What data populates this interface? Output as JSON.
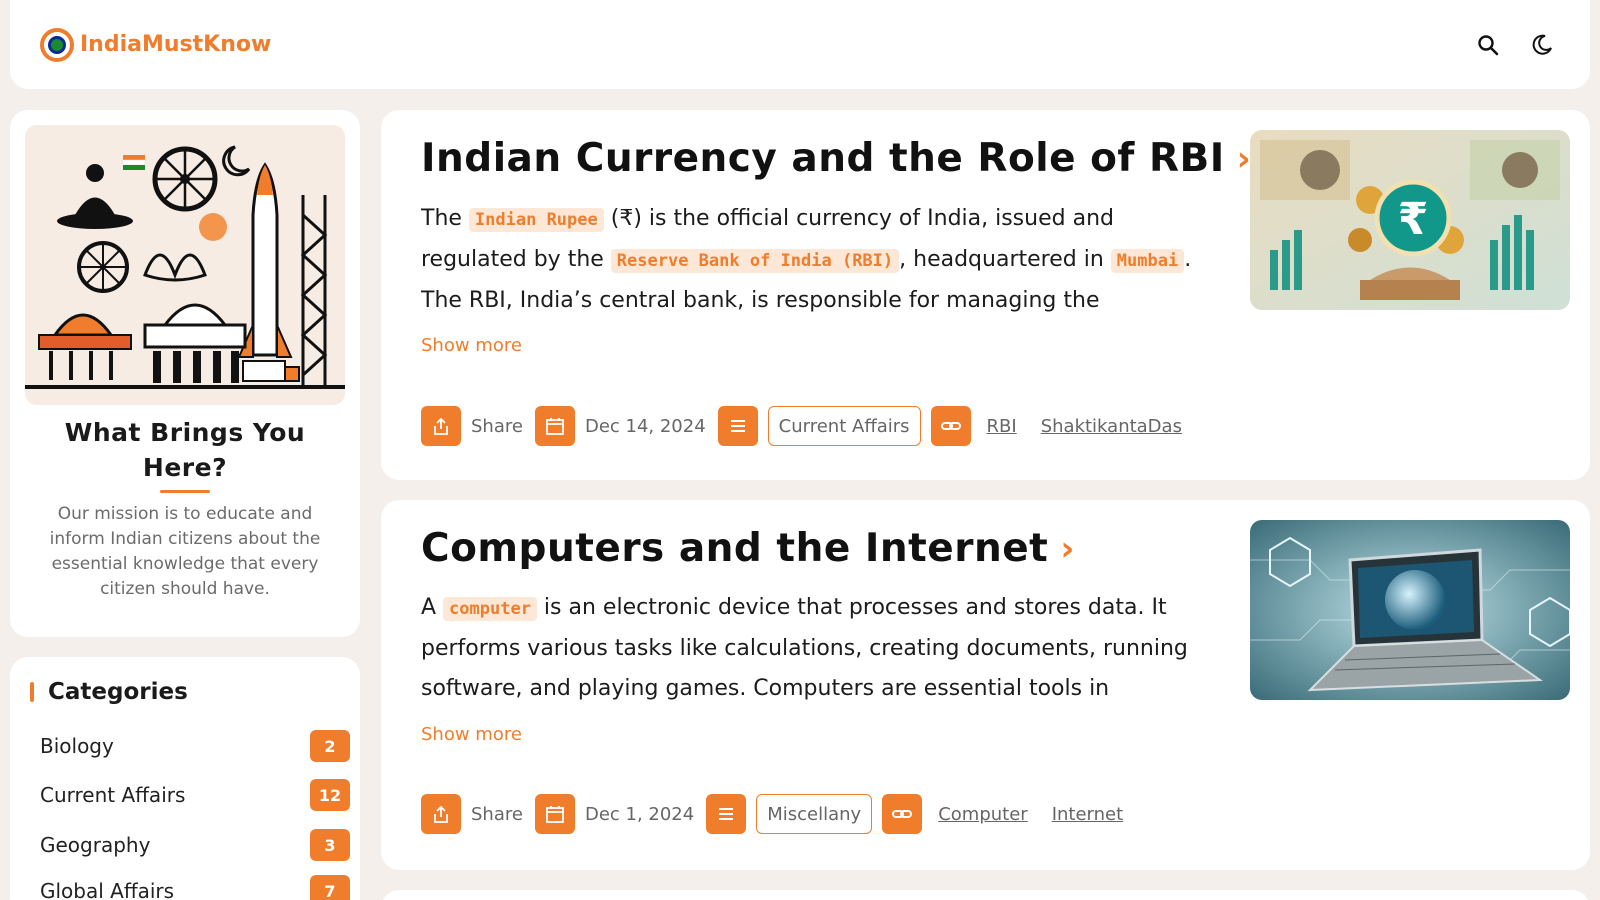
{
  "header": {
    "brand": "IndiaMustKnow",
    "icons": [
      "search-icon",
      "moon-icon"
    ]
  },
  "colors": {
    "accent": "#f07d2b",
    "background": "#f4efea",
    "tag_bg": "#fde8d8"
  },
  "sidebar": {
    "title": "What Brings You Here?",
    "text": "Our mission is to educate and inform Indian citizens about the essential knowledge that every citizen should have."
  },
  "categories": {
    "heading": "Categories",
    "items": [
      {
        "name": "Biology",
        "count": "2"
      },
      {
        "name": "Current Affairs",
        "count": "12"
      },
      {
        "name": "Geography",
        "count": "3"
      },
      {
        "name": "Global Affairs",
        "count": "7"
      }
    ]
  },
  "posts": [
    {
      "title": "Indian Currency and the Role of RBI",
      "body": {
        "p1": "The ",
        "t1": "Indian Rupee",
        "p2": " (₹) is the official currency of India, issued and regulated by the ",
        "t2": "Reserve Bank of India (RBI)",
        "p3": ", headquartered in ",
        "t3": "Mumbai",
        "p4": ". The RBI, India’s central bank, is responsible for managing the"
      },
      "show_more": "Show more",
      "share": "Share",
      "date": "Dec 14, 2024",
      "category": "Current Affairs",
      "tags": [
        "RBI",
        "ShaktikantaDas"
      ]
    },
    {
      "title": "Computers and the Internet",
      "body": {
        "p1": "A ",
        "t1": "computer",
        "p2": " is an electronic device that processes and stores data. It performs various tasks like calculations, creating documents, running software, and playing games. Computers are essential tools in"
      },
      "show_more": "Show more",
      "share": "Share",
      "date": "Dec 1, 2024",
      "category": "Miscellany",
      "tags": [
        "Computer",
        "Internet"
      ]
    }
  ]
}
